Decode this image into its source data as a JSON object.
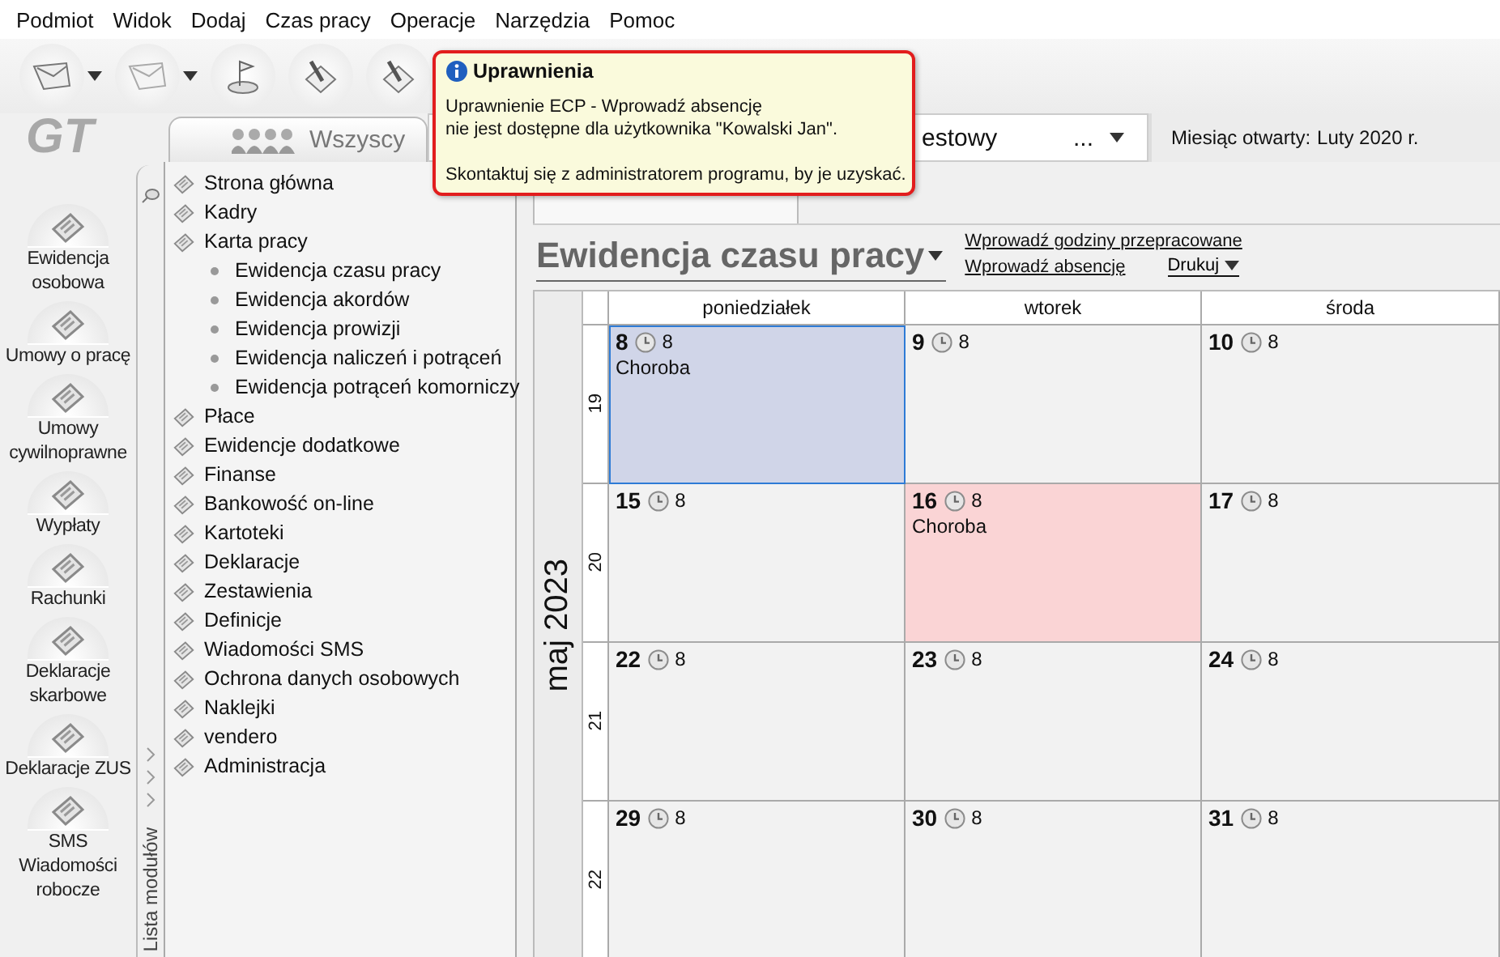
{
  "menu": [
    "Podmiot",
    "Widok",
    "Dodaj",
    "Czas pracy",
    "Operacje",
    "Narzędzia",
    "Pomoc"
  ],
  "logo": "GT",
  "scope_tab": {
    "label": "Wszyscy"
  },
  "company_combo": {
    "value": "estowy",
    "more": "..."
  },
  "open_month": {
    "label": "Miesiąc otwarty:",
    "value": "Luty 2020 r."
  },
  "nav": [
    {
      "label": "Ewidencja osobowa"
    },
    {
      "label": "Umowy o pracę"
    },
    {
      "label": "Umowy cywilnoprawne"
    },
    {
      "label": "Wypłaty"
    },
    {
      "label": "Rachunki"
    },
    {
      "label": "Deklaracje skarbowe"
    },
    {
      "label": "Deklaracje ZUS"
    },
    {
      "label": "SMS Wiadomości robocze"
    }
  ],
  "module_strip": {
    "label": "Lista modułów"
  },
  "tree": [
    {
      "label": "Strona główna"
    },
    {
      "label": "Kadry"
    },
    {
      "label": "Karta pracy",
      "children": [
        {
          "label": "Ewidencja czasu pracy"
        },
        {
          "label": "Ewidencja akordów"
        },
        {
          "label": "Ewidencja prowizji"
        },
        {
          "label": "Ewidencja naliczeń i potrąceń"
        },
        {
          "label": "Ewidencja potrąceń komorniczy"
        }
      ]
    },
    {
      "label": "Płace"
    },
    {
      "label": "Ewidencje dodatkowe"
    },
    {
      "label": "Finanse"
    },
    {
      "label": "Bankowość on-line"
    },
    {
      "label": "Kartoteki"
    },
    {
      "label": "Deklaracje"
    },
    {
      "label": "Zestawienia"
    },
    {
      "label": "Definicje"
    },
    {
      "label": "Wiadomości SMS"
    },
    {
      "label": "Ochrona danych osobowych"
    },
    {
      "label": "Naklejki"
    },
    {
      "label": "vendero"
    },
    {
      "label": "Administracja"
    }
  ],
  "view": {
    "title": "Ewidencja czasu pracy",
    "links": [
      {
        "label": "Wprowadź godziny przepracowane"
      },
      {
        "label": "Wprowadź absencję"
      }
    ],
    "print": {
      "label": "Drukuj"
    }
  },
  "calendar": {
    "month": "maj 2023",
    "columns": [
      "poniedziałek",
      "wtorek",
      "środa"
    ],
    "weeks": [
      {
        "number": "19",
        "days": [
          {
            "day": "8",
            "hours": "8",
            "note": "Choroba",
            "selected": true,
            "color": "#d0d5e8"
          },
          {
            "day": "9",
            "hours": "8",
            "selected": false,
            "color": "#f2f2f2"
          },
          {
            "day": "10",
            "hours": "8",
            "selected": false,
            "color": "#f2f2f2"
          }
        ]
      },
      {
        "number": "20",
        "days": [
          {
            "day": "15",
            "hours": "8",
            "selected": false,
            "color": "#f2f2f2"
          },
          {
            "day": "16",
            "hours": "8",
            "note": "Choroba",
            "selected": false,
            "color": "#fad4d5"
          },
          {
            "day": "17",
            "hours": "8",
            "selected": false,
            "color": "#f2f2f2"
          }
        ]
      },
      {
        "number": "21",
        "days": [
          {
            "day": "22",
            "hours": "8",
            "selected": false,
            "color": "#f2f2f2"
          },
          {
            "day": "23",
            "hours": "8",
            "selected": false,
            "color": "#f2f2f2"
          },
          {
            "day": "24",
            "hours": "8",
            "selected": false,
            "color": "#f2f2f2"
          }
        ]
      },
      {
        "number": "22",
        "days": [
          {
            "day": "29",
            "hours": "8",
            "selected": false,
            "color": "#f2f2f2"
          },
          {
            "day": "30",
            "hours": "8",
            "selected": false,
            "color": "#f2f2f2"
          },
          {
            "day": "31",
            "hours": "8",
            "selected": false,
            "color": "#f2f2f2"
          }
        ]
      }
    ]
  },
  "tooltip": {
    "title": "Uprawnienia",
    "lines": [
      "Uprawnienie ECP - Wprowadź absencję",
      "nie jest dostępne dla użytkownika \"Kowalski Jan\".",
      "Skontaktuj się z administratorem programu, by je uzyskać."
    ]
  }
}
